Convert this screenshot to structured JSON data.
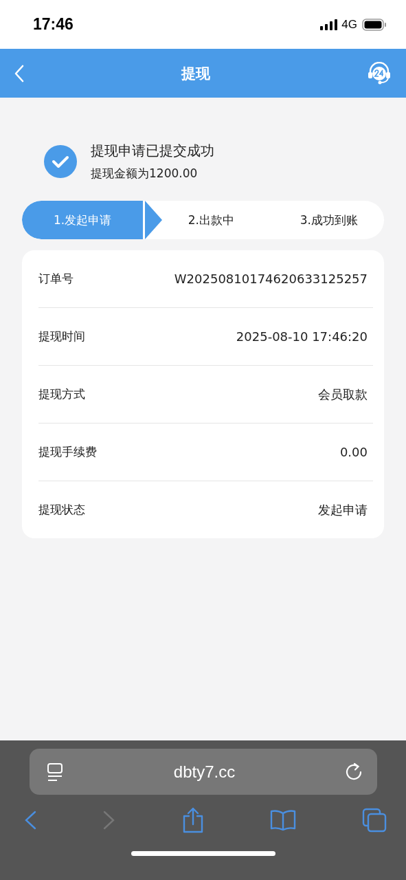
{
  "status_bar": {
    "time": "17:46",
    "network": "4G"
  },
  "nav": {
    "title": "提现"
  },
  "result": {
    "title": "提现申请已提交成功",
    "subtitle": "提现金额为1200.00"
  },
  "steps": [
    {
      "label": "1.发起申请",
      "selected": true
    },
    {
      "label": "2.出款中",
      "selected": false
    },
    {
      "label": "3.成功到账",
      "selected": false
    }
  ],
  "details": [
    {
      "label": "订单号",
      "value": "W20250810174620633125257"
    },
    {
      "label": "提现时间",
      "value": "2025-08-10 17:46:20"
    },
    {
      "label": "提现方式",
      "value": "会员取款"
    },
    {
      "label": "提现手续费",
      "value": "0.00"
    },
    {
      "label": "提现状态",
      "value": "发起申请"
    }
  ],
  "browser": {
    "url": "dbty7.cc",
    "toolbar": [
      {
        "kind": "back",
        "disabled": false
      },
      {
        "kind": "forward",
        "disabled": true
      },
      {
        "kind": "share",
        "disabled": false
      },
      {
        "kind": "bookmarks",
        "disabled": false
      },
      {
        "kind": "tabs",
        "disabled": false
      }
    ]
  }
}
